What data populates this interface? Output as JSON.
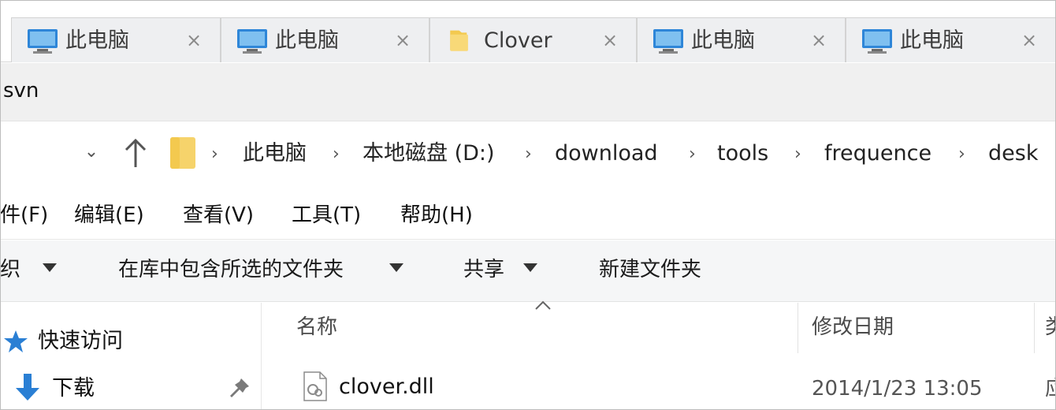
{
  "tabs": [
    {
      "label": "此电脑",
      "icon": "monitor-icon"
    },
    {
      "label": "此电脑",
      "icon": "monitor-icon"
    },
    {
      "label": "Clover",
      "icon": "folder-icon"
    },
    {
      "label": "此电脑",
      "icon": "monitor-icon"
    },
    {
      "label": "此电脑",
      "icon": "monitor-icon"
    }
  ],
  "tab_close_glyph": "×",
  "window": {
    "title": "svn"
  },
  "address": {
    "recent_glyph": "⌄",
    "separator": "›",
    "crumbs": [
      "此电脑",
      "本地磁盘 (D:)",
      "download",
      "tools",
      "frequence",
      "desk"
    ]
  },
  "menu": [
    "件(F)",
    "编辑(E)",
    "查看(V)",
    "工具(T)",
    "帮助(H)"
  ],
  "toolbar": {
    "organize": "组织",
    "include_in_library": "在库中包含所选的文件夹",
    "share": "共享",
    "new_folder": "新建文件夹"
  },
  "nav": {
    "quick_access": "快速访问",
    "downloads": "下载"
  },
  "columns": {
    "name": "名称",
    "modified": "修改日期",
    "type_peek": "类"
  },
  "files": [
    {
      "name": "clover.dll",
      "modified": "2014/1/23 13:05",
      "type_peek": "应"
    }
  ],
  "colors": {
    "accent_blue": "#1f78d1",
    "folder_yellow": "#f6d36b",
    "tab_background": "#eeeff1"
  }
}
